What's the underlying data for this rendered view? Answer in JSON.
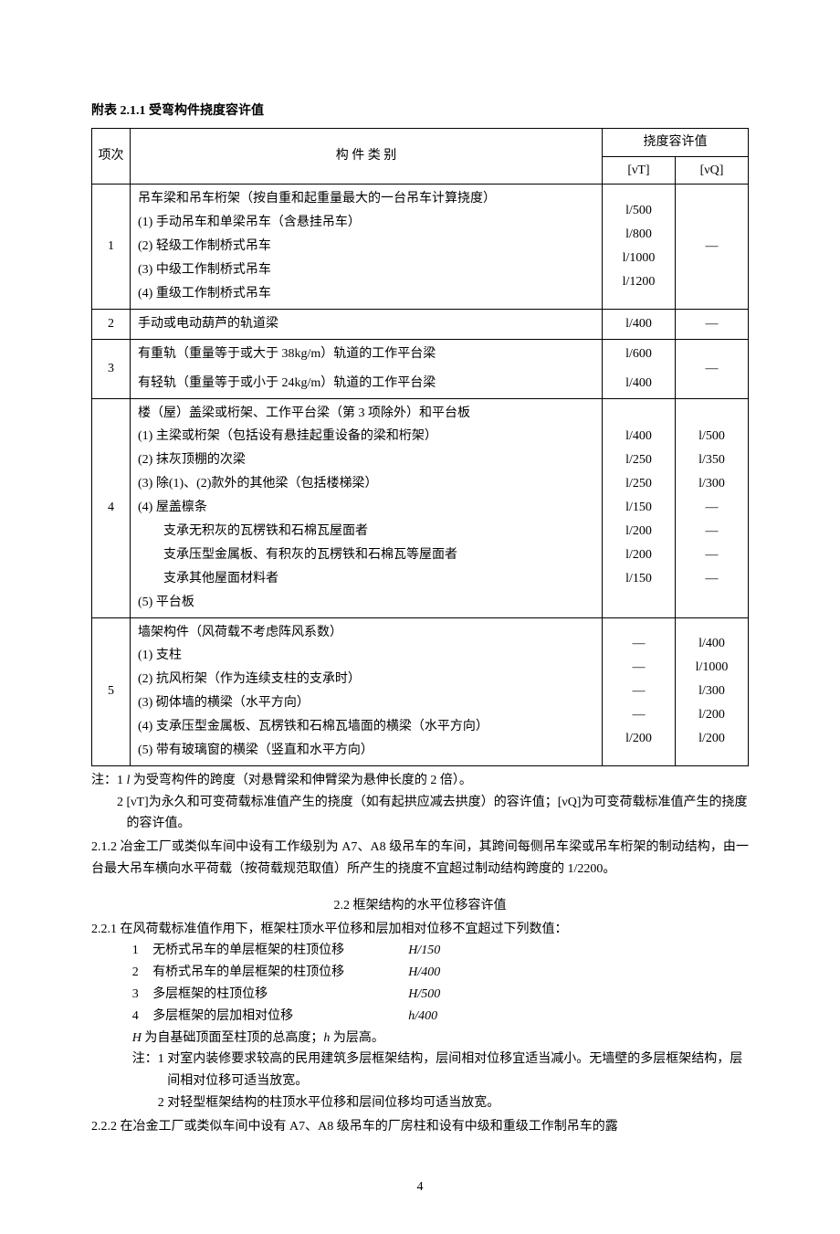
{
  "table_title": "附表 2.1.1  受弯构件挠度容许值",
  "headers": {
    "item": "项次",
    "category": "构  件  类  别",
    "allow": "挠度容许值",
    "vt": "[νT]",
    "vq": "[νQ]"
  },
  "rows": [
    {
      "idx": "1",
      "lines": [
        "吊车梁和吊车桁架（按自重和起重量最大的一台吊车计算挠度）",
        "(1)  手动吊车和单梁吊车（含悬挂吊车）",
        "(2)  轻级工作制桥式吊车",
        "(3)  中级工作制桥式吊车",
        "(4)  重级工作制桥式吊车"
      ],
      "vt": [
        "",
        "l/500",
        "l/800",
        "l/1000",
        "l/1200"
      ],
      "vq": [
        "",
        "",
        "—",
        "",
        ""
      ]
    },
    {
      "idx": "2",
      "lines": [
        "手动或电动葫芦的轨道梁"
      ],
      "vt": [
        "l/400"
      ],
      "vq": [
        "—"
      ]
    },
    {
      "idx": "3",
      "lines": [
        "有重轨（重量等于或大于 38kg/m）轨道的工作平台梁",
        "有轻轨（重量等于或小于 24kg/m）轨道的工作平台梁"
      ],
      "vt": [
        "l/600",
        "l/400"
      ],
      "vq_single": "—"
    },
    {
      "idx": "4",
      "lines": [
        "楼（屋）盖梁或桁架、工作平台梁（第 3 项除外）和平台板",
        "(1)  主梁或桁架（包括设有悬挂起重设备的梁和桁架）",
        "(2)  抹灰顶棚的次梁",
        "(3)  除(1)、(2)款外的其他梁（包括楼梯梁）",
        "(4)  屋盖檩条",
        "        支承无积灰的瓦楞铁和石棉瓦屋面者",
        "        支承压型金属板、有积灰的瓦楞铁和石棉瓦等屋面者",
        "        支承其他屋面材料者",
        "(5)  平台板"
      ],
      "vt": [
        "",
        "l/400",
        "l/250",
        "l/250",
        "",
        "l/150",
        "l/200",
        "l/200",
        "l/150"
      ],
      "vq": [
        "",
        "l/500",
        "l/350",
        "l/300",
        "",
        "—",
        "—",
        "—",
        "—"
      ]
    },
    {
      "idx": "5",
      "lines": [
        "墙架构件（风荷载不考虑阵风系数）",
        "(1)  支柱",
        "(2)  抗风桁架（作为连续支柱的支承时）",
        "(3)  砌体墙的横梁（水平方向）",
        "(4)  支承压型金属板、瓦楞铁和石棉瓦墙面的横梁（水平方向）",
        "(5)  带有玻璃窗的横梁（竖直和水平方向）"
      ],
      "vt": [
        "",
        "—",
        "—",
        "—",
        "—",
        "l/200"
      ],
      "vq": [
        "",
        "l/400",
        "l/1000",
        "l/300",
        "l/200",
        "l/200"
      ]
    }
  ],
  "table_notes": {
    "label": "注：",
    "n1_num": "1",
    "n1": "l 为受弯构件的跨度（对悬臂梁和伸臂梁为悬伸长度的 2 倍）。",
    "n2_num": "2",
    "n2": "[νT]为永久和可变荷载标准值产生的挠度（如有起拱应减去拱度）的容许值；[νQ]为可变荷载标准值产生的挠度的容许值。"
  },
  "para212": "2.1.2 冶金工厂或类似车间中设有工作级别为 A7、A8 级吊车的车间，其跨间每侧吊车梁或吊车桁架的制动结构，由一台最大吊车横向水平荷载（按荷载规范取值）所产生的挠度不宜超过制动结构跨度的 1/2200。",
  "sec22_title": "2.2  框架结构的水平位移容许值",
  "para221_lead": "2.2.1  在风荷载标准值作用下，框架柱顶水平位移和层加相对位移不宜超过下列数值：",
  "list221": [
    {
      "n": "1",
      "d": "无桥式吊车的单层框架的柱顶位移",
      "v": "H/150"
    },
    {
      "n": "2",
      "d": "有桥式吊车的单层框架的柱顶位移",
      "v": "H/400"
    },
    {
      "n": "3",
      "d": "多层框架的柱顶位移",
      "v": "H/500"
    },
    {
      "n": "4",
      "d": "多层框架的层加相对位移",
      "v": "h/400"
    }
  ],
  "hnote": "H 为自基础顶面至柱顶的总高度；h 为层高。",
  "subnotes": {
    "label": "注：",
    "n1_num": "1",
    "n1": "对室内装修要求较高的民用建筑多层框架结构，层间相对位移宜适当减小。无墙壁的多层框架结构，层间相对位移可适当放宽。",
    "n2_num": "2",
    "n2": "对轻型框架结构的柱顶水平位移和层间位移均可适当放宽。"
  },
  "para222": "2.2.2 在冶金工厂或类似车间中设有 A7、A8 级吊车的厂房柱和设有中级和重级工作制吊车的露",
  "page_number": "4"
}
